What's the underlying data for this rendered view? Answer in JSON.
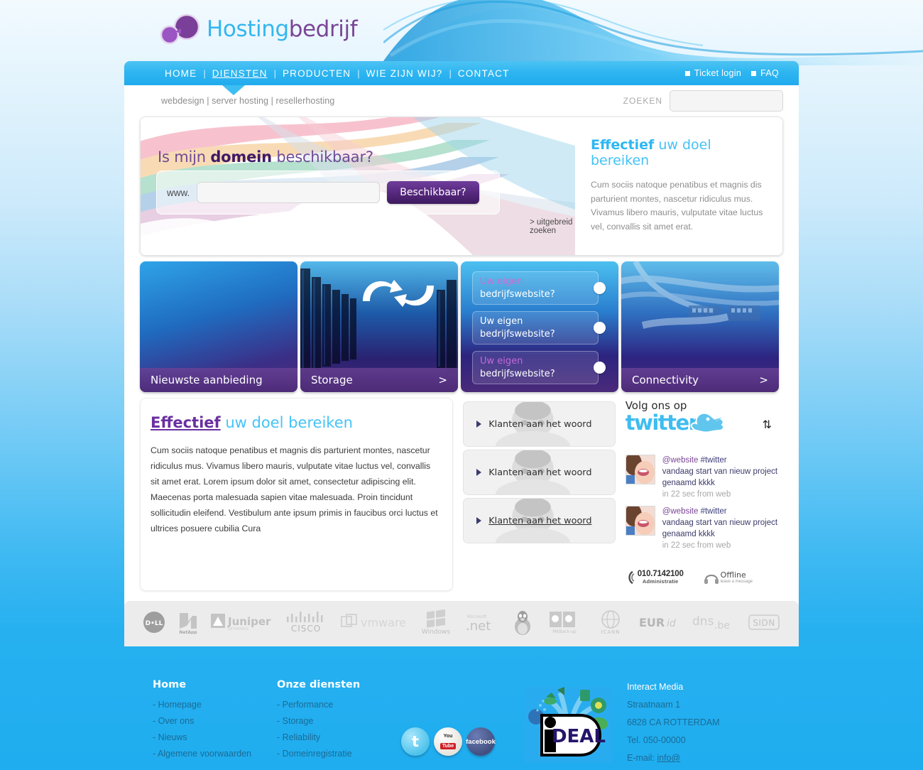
{
  "brand": {
    "name_part1": "Hosting",
    "name_part2": "bedrijf",
    "logo_icon": "molecule-icon"
  },
  "nav": {
    "items": [
      {
        "label": "HOME",
        "active": false
      },
      {
        "label": "DIENSTEN",
        "active": true
      },
      {
        "label": "PRODUCTEN",
        "active": false
      },
      {
        "label": "WIE ZIJN WIJ?",
        "active": false
      },
      {
        "label": "CONTACT",
        "active": false
      }
    ],
    "separator": "|",
    "utility": [
      {
        "label": "Ticket login"
      },
      {
        "label": "FAQ"
      }
    ]
  },
  "subbar": {
    "breadcrumb": "webdesign | server hosting | resellerhosting",
    "search_label": "ZOEKEN",
    "search_value": "",
    "search_placeholder": ""
  },
  "hero": {
    "title_pre": "Is mijn ",
    "title_bold": "domein",
    "title_post": " beschikbaar?",
    "www_prefix": "www.",
    "domain_value": "",
    "domain_placeholder": "",
    "submit_label": "Beschikbaar?",
    "advanced_link": "> uitgebreid zoeken",
    "right_title_bold": "Effectief",
    "right_title_rest": " uw doel bereiken",
    "right_body": "Cum sociis natoque penatibus et magnis dis parturient montes, nascetur ridiculus mus. Vivamus libero mauris, vulputate vitae luctus vel, convallis sit amet erat."
  },
  "boxes": [
    {
      "caption": "Nieuwste aanbieding",
      "chevron": "",
      "image": "blue-gradient"
    },
    {
      "caption": "Storage",
      "chevron": ">",
      "image": "server-racks-photo"
    },
    {
      "caption": "",
      "chevron": "",
      "image": "blue-gradient",
      "list": [
        {
          "line1": "Uw eigen",
          "line2": "bedrijfswebsite?"
        },
        {
          "line1": "Uw eigen",
          "line2": "bedrijfswebsite?"
        },
        {
          "line1": "Uw eigen",
          "line2": "bedrijfswebsite?"
        }
      ]
    },
    {
      "caption": "Connectivity",
      "chevron": ">",
      "image": "network-cables-photo"
    }
  ],
  "main": {
    "title_bold": "Effectief",
    "title_rest": " uw doel bereiken",
    "body": "Cum sociis natoque penatibus et magnis dis parturient montes, nascetur ridiculus mus. Vivamus libero mauris, vulputate vitae luctus vel, convallis sit amet erat. Lorem ipsum dolor sit amet, consectetur adipiscing elit. Maecenas porta malesuada sapien vitae malesuada. Proin tincidunt sollicitudin eleifend. Vestibulum ante ipsum primis in faucibus orci luctus et ultrices posuere cubilia Cura"
  },
  "testimonials": [
    {
      "label": "Klanten aan het woord",
      "underlined": false
    },
    {
      "label": "Klanten aan het woord",
      "underlined": false
    },
    {
      "label": "Klanten aan het woord",
      "underlined": true
    }
  ],
  "twitter": {
    "follow_label": "Volg ons op",
    "logo_text": "twitter",
    "refresh_icon": "refresh-icon",
    "tweets": [
      {
        "handle": "@website",
        "tag": " #twitter",
        "text": "vandaag start van nieuw project genaamd kkkk",
        "meta": "in 22 sec from web"
      },
      {
        "handle": "@website",
        "tag": " #twitter",
        "text": "vandaag start van nieuw project genaamd kkkk",
        "meta": "in 22 sec from web"
      }
    ]
  },
  "badges": {
    "phone_number": "010.7142100",
    "phone_sub": "Administratie",
    "chat_status": "Offline",
    "chat_sub": "leave a message"
  },
  "partners": [
    {
      "name": "DELL"
    },
    {
      "name": "NetApp"
    },
    {
      "name": "Juniper"
    },
    {
      "name": "CISCO"
    },
    {
      "name": "vmware"
    },
    {
      "name": "Windows"
    },
    {
      "name": ".net"
    },
    {
      "name": "Linux"
    },
    {
      "name": "MKB back-up"
    },
    {
      "name": "ICANN"
    },
    {
      "name": "EURid"
    },
    {
      "name": "dns.be"
    },
    {
      "name": "SIDN"
    }
  ],
  "footer": {
    "col1": {
      "heading": "Home",
      "links": [
        "- Homepage",
        "- Over ons",
        "- Nieuws",
        "- Algemene voorwaarden"
      ]
    },
    "col2": {
      "heading": "Onze diensten",
      "links": [
        "- Performance",
        "- Storage",
        "- Reliability",
        "- Domeinregistratie"
      ]
    },
    "social": [
      {
        "name": "twitter-icon",
        "label": "t"
      },
      {
        "name": "youtube-icon",
        "label": "You Tube"
      },
      {
        "name": "facebook-icon",
        "label": "facebook"
      }
    ],
    "payment": {
      "name": "ideal-logo",
      "label": "iDEAL"
    },
    "address": {
      "company": "Interact Media",
      "street": "Straatnaam 1",
      "city": "6828 CA ROTTERDAM",
      "tel": "Tel. 050-00000",
      "email_prefix": "E-mail: ",
      "email": "info@"
    }
  },
  "colors": {
    "brand_blue": "#22acf0",
    "brand_purple": "#7a4596",
    "nav_blue": "#2fb6f1",
    "footer_link": "#1b6b95"
  }
}
